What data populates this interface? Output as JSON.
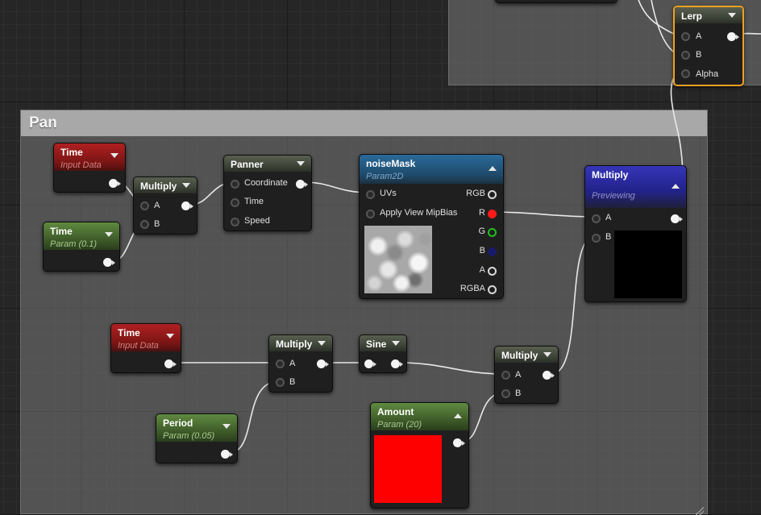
{
  "comments": {
    "pan_title": "Pan"
  },
  "nodes": {
    "lerp": {
      "title": "Lerp",
      "pins": [
        "A",
        "B",
        "Alpha"
      ]
    },
    "time1": {
      "title": "Time",
      "subtitle": "Input Data"
    },
    "time2": {
      "title": "Time",
      "subtitle": "Param (0.1)"
    },
    "multiply1": {
      "title": "Multiply",
      "pins": [
        "A",
        "B"
      ]
    },
    "panner": {
      "title": "Panner",
      "pins": [
        "Coordinate",
        "Time",
        "Speed"
      ]
    },
    "noise": {
      "title": "noiseMask",
      "subtitle": "Param2D",
      "inputs": [
        "UVs",
        "Apply View MipBias"
      ],
      "outputs": [
        "RGB",
        "R",
        "G",
        "B",
        "A",
        "RGBA"
      ]
    },
    "multiply_preview": {
      "title": "Multiply",
      "subtitle": "Previewing",
      "pins": [
        "A",
        "B"
      ]
    },
    "time3": {
      "title": "Time",
      "subtitle": "Input Data"
    },
    "multiply2": {
      "title": "Multiply",
      "pins": [
        "A",
        "B"
      ]
    },
    "sine": {
      "title": "Sine"
    },
    "multiply3": {
      "title": "Multiply",
      "pins": [
        "A",
        "B"
      ]
    },
    "period": {
      "title": "Period",
      "subtitle": "Param (0.05)"
    },
    "amount": {
      "title": "Amount",
      "subtitle": "Param (20)"
    }
  },
  "colors": {
    "param_header": "#3a5526",
    "time_header": "#7a1515",
    "math_header": "#3a4034",
    "texture_header": "#1e4a6a",
    "preview_header": "#22228a",
    "selection": "#f0a020",
    "amount_swatch": "#ff0000",
    "preview_swatch": "#000000"
  }
}
